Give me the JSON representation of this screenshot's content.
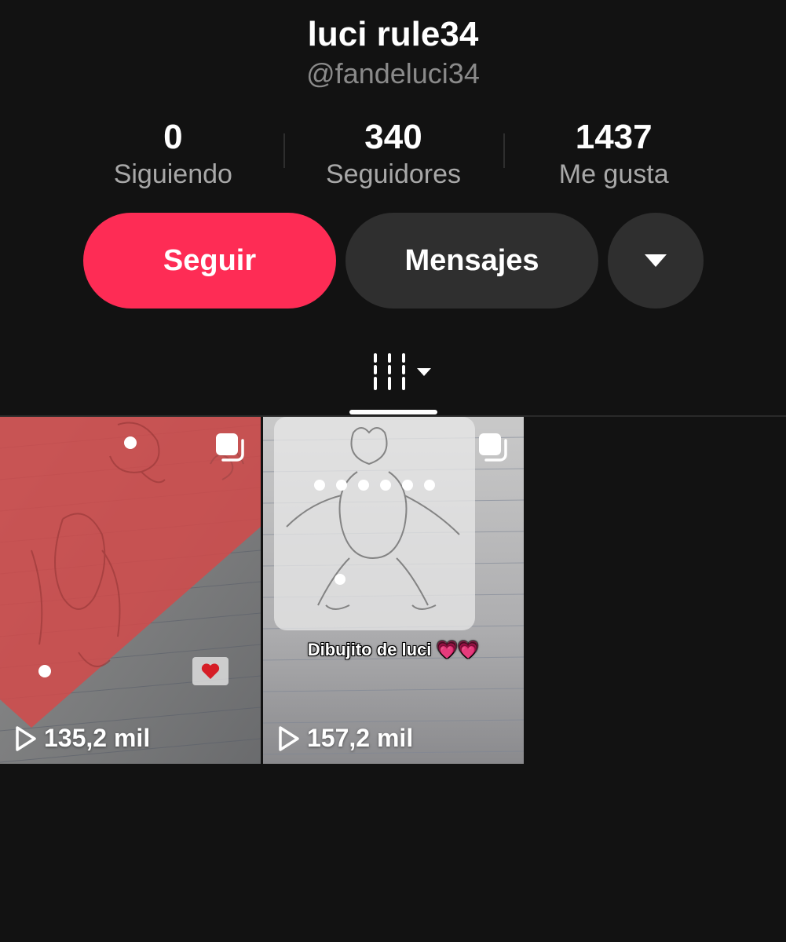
{
  "profile": {
    "name": "luci rule34",
    "handle": "@fandeluci34"
  },
  "stats": [
    {
      "value": "0",
      "label": "Siguiendo"
    },
    {
      "value": "340",
      "label": "Seguidores"
    },
    {
      "value": "1437",
      "label": "Me gusta"
    }
  ],
  "actions": {
    "follow_label": "Seguir",
    "message_label": "Mensajes",
    "more_icon": "triangle-down-icon"
  },
  "tabs": {
    "active_icon": "grid-icon",
    "dropdown_icon": "caret-down-icon"
  },
  "videos": [
    {
      "views": "135,2 mil",
      "caption": "",
      "multi_icon": "multi-photo-icon"
    },
    {
      "views": "157,2 mil",
      "caption": "Dibujito de luci 💗💗",
      "multi_icon": "multi-photo-icon"
    }
  ],
  "colors": {
    "background": "#121212",
    "follow_button": "#fe2c55",
    "secondary_button": "#2f2f2f",
    "handle_text": "#8a8a8a"
  }
}
